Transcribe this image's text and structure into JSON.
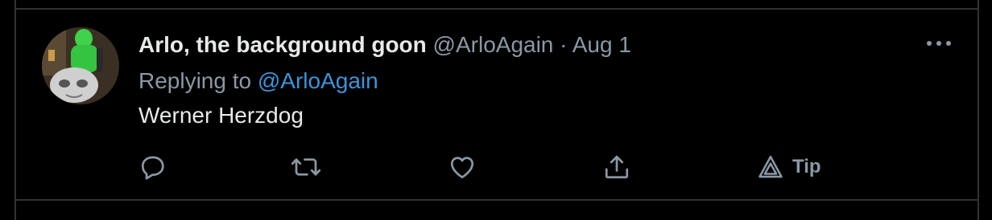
{
  "tweet": {
    "display_name": "Arlo, the background goon",
    "handle": "@ArloAgain",
    "separator": "·",
    "date": "Aug 1",
    "replying_prefix": "Replying to ",
    "replying_handle": "@ArloAgain",
    "text": "Werner Herzdog"
  },
  "actions": {
    "reply_icon": "reply-icon",
    "retweet_icon": "retweet-icon",
    "like_icon": "heart-icon",
    "share_icon": "share-icon",
    "tip_icon": "tip-icon",
    "tip_label": "Tip"
  },
  "menu": {
    "more_icon": "more-icon"
  },
  "colors": {
    "background": "#000000",
    "primary_text": "#e7e9ea",
    "secondary_text": "#8b98a5",
    "link": "#3b94d9",
    "border": "#2f3336"
  }
}
